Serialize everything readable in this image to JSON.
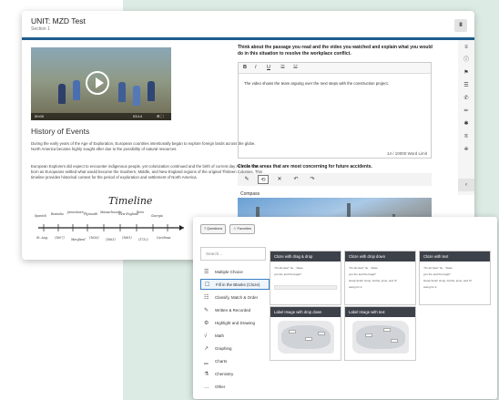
{
  "unit": {
    "title": "UNIT: MZD Test",
    "section": "Section 1"
  },
  "pause_label": "II",
  "video": {
    "time_left": "00:00",
    "time_right": "03:14",
    "controls": "⚙ ⛶"
  },
  "reading": {
    "heading": "History of Events",
    "p1": "During the early years of the Age of Exploration, European countries intentionally began to explore foreign lands across the globe. North America became highly sought after due to the possibility of natural resources.",
    "p2": "European Explorers did expect to encounter indigenous people, yet colonization continued and the birth of current day America was born as Europeans settled what would become the Southern, Middle, and New England regions of the original Thirteen Colonies. This timeline provides historical context for the period of exploration and settlement of North America.",
    "timeline_title": "Timeline"
  },
  "question": {
    "prompt": "Think about the passage you read and the video you watched and explain what you would do in this situation to resolve the workplace conflict.",
    "toolbar": [
      "B",
      "I",
      "U",
      "☰",
      "☱"
    ],
    "answer": "The video shows the team arguing over the next steps with the construction project.",
    "word_count": "14 / 10000 Word Limit"
  },
  "circle": {
    "prompt": "Circle the areas that are most concerning for future accidents.",
    "tools": [
      "✎",
      "⟲",
      "✕",
      "↶",
      "↷"
    ],
    "image_label": "Compass"
  },
  "side_tools": [
    "≡",
    "ⓘ",
    "⚑",
    "☰",
    "✆",
    "✏",
    "✱",
    "π",
    "⎈",
    "‹"
  ],
  "picker": {
    "tabs": [
      "? Questions",
      "☆ Favorites"
    ],
    "search_placeholder": "Search...",
    "categories": [
      {
        "label": "Multiple Choice",
        "icon": "☰"
      },
      {
        "label": "Fill in the Blanks (Cloze)",
        "icon": "☐"
      },
      {
        "label": "Classify, Match & Order",
        "icon": "☷"
      },
      {
        "label": "Written & Recorded",
        "icon": "✎"
      },
      {
        "label": "Highlight and Drawing",
        "icon": "⚙"
      },
      {
        "label": "Math",
        "icon": "√"
      },
      {
        "label": "Graphing",
        "icon": "↗"
      },
      {
        "label": "Charts",
        "icon": "▁"
      },
      {
        "label": "Chemistry",
        "icon": "⚗"
      },
      {
        "label": "Other",
        "icon": "…"
      }
    ],
    "cards": [
      {
        "title": "Cloze with drag & drop"
      },
      {
        "title": "Cloze with drop down"
      },
      {
        "title": "Cloze with text"
      },
      {
        "title": "Label Image with drop down"
      },
      {
        "title": "Label Image with text"
      }
    ],
    "cloze_text": {
      "t1": "\"It's all clear\" he",
      "t2": ", \"Have",
      "t3": "you the",
      "t4": "and the bags?",
      "t5": "Great Scott! Jump, Archie, jump, and I'll",
      "t6": "swing for it."
    }
  },
  "colors": {
    "accent": "#1c5c8e",
    "card_header": "#3d4149",
    "mint": "#dcebe4"
  }
}
